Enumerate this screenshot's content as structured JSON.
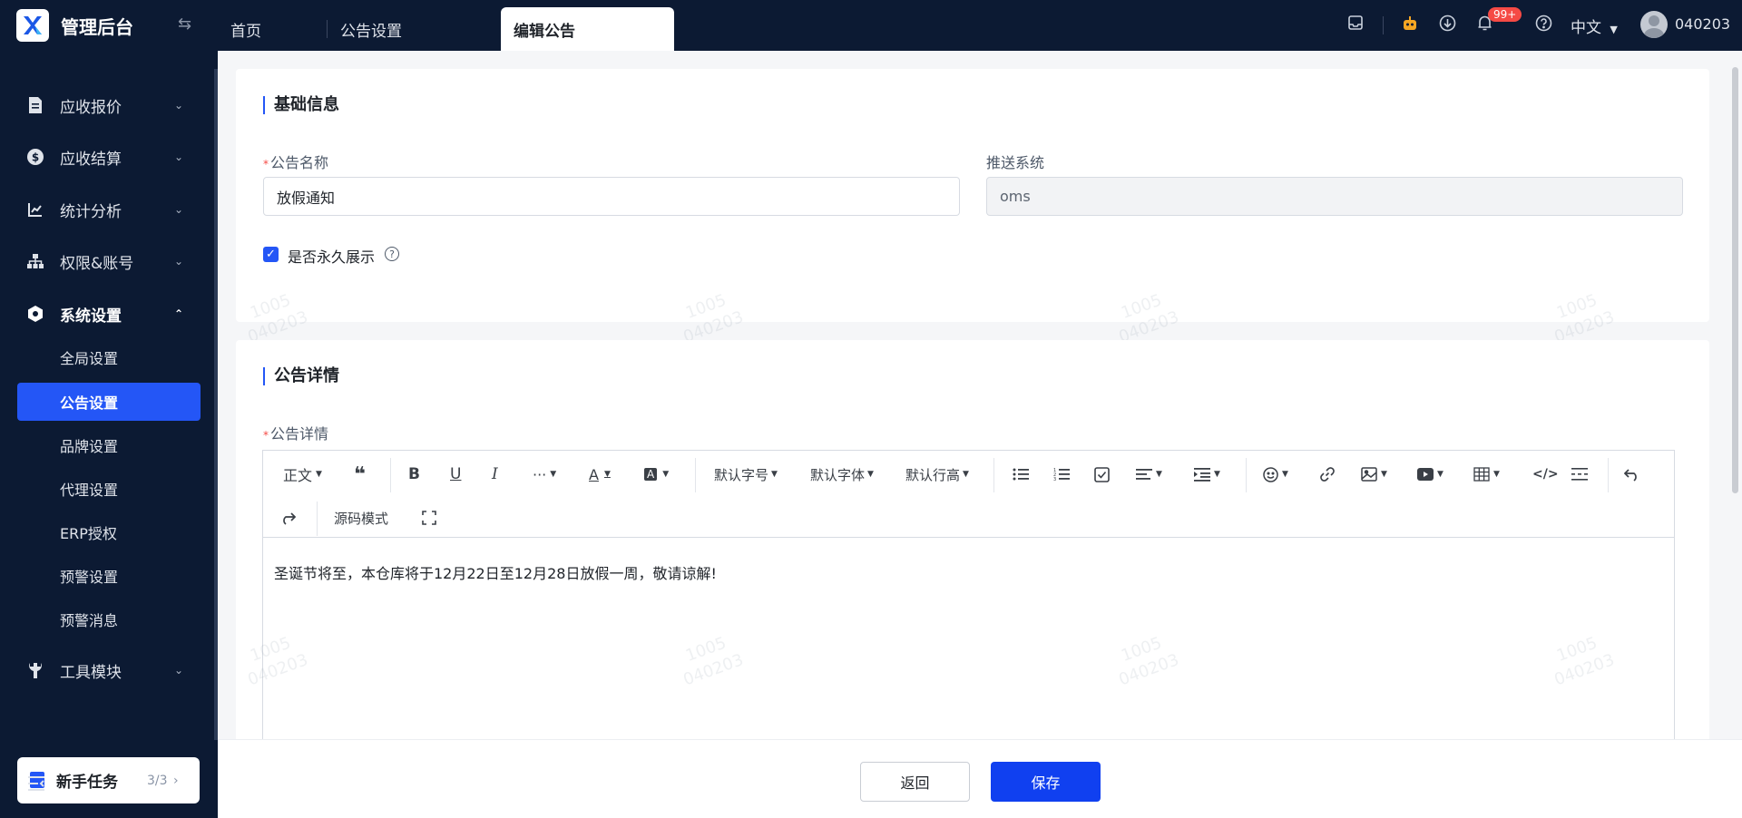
{
  "app": {
    "title": "管理后台"
  },
  "tabs": [
    {
      "label": "首页"
    },
    {
      "label": "公告设置"
    },
    {
      "label": "编辑公告"
    }
  ],
  "topbar": {
    "notification_count": "99+",
    "language": "中文",
    "username": "040203"
  },
  "sidebar": {
    "items": [
      {
        "label": "应收报价",
        "icon": "document-icon"
      },
      {
        "label": "应收结算",
        "icon": "dollar-icon"
      },
      {
        "label": "统计分析",
        "icon": "chart-icon"
      },
      {
        "label": "权限&账号",
        "icon": "org-chart-icon"
      },
      {
        "label": "系统设置",
        "icon": "settings-hexagon-icon"
      },
      {
        "label": "工具模块",
        "icon": "wrench-icon"
      }
    ],
    "sub_items": [
      {
        "label": "全局设置"
      },
      {
        "label": "公告设置"
      },
      {
        "label": "品牌设置"
      },
      {
        "label": "代理设置"
      },
      {
        "label": "ERP授权"
      },
      {
        "label": "预警设置"
      },
      {
        "label": "预警消息"
      }
    ],
    "task_card": {
      "label": "新手任务",
      "count": "3/3"
    }
  },
  "basic_info": {
    "title": "基础信息",
    "name_label": "公告名称",
    "name_value": "放假通知",
    "push_label": "推送系统",
    "push_value": "oms",
    "permanent_label": "是否永久展示",
    "permanent_checked": true
  },
  "details": {
    "title": "公告详情",
    "field_label": "公告详情",
    "toolbar": {
      "paragraph": "正文",
      "font_size": "默认字号",
      "font_family": "默认字体",
      "line_height": "默认行高",
      "source_mode": "源码模式"
    },
    "content": "圣诞节将至，本仓库将于12月22日至12月28日放假一周，敬请谅解!"
  },
  "footer": {
    "back_label": "返回",
    "save_label": "保存"
  },
  "watermark": {
    "line1": "1005",
    "line2": "040203"
  },
  "colors": {
    "primary": "#2456f6",
    "sidebar_bg": "#0c1a33",
    "badge": "#f54a45"
  }
}
